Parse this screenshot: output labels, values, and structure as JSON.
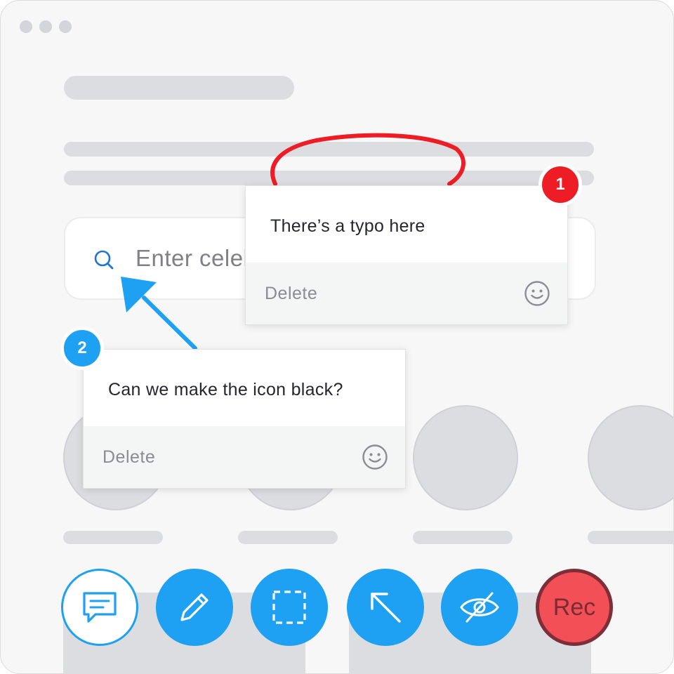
{
  "search": {
    "placeholder": "Enter celebrity name"
  },
  "comments": [
    {
      "number": "1",
      "text": "There’s a typo here",
      "delete_label": "Delete",
      "badge_color": "#ee1c25"
    },
    {
      "number": "2",
      "text": "Can we make the icon black?",
      "delete_label": "Delete",
      "badge_color": "#1ea1f2"
    }
  ],
  "toolbar": {
    "tools": [
      {
        "name": "comment",
        "icon": "comment-icon",
        "active": true
      },
      {
        "name": "draw",
        "icon": "pencil-icon"
      },
      {
        "name": "select-area",
        "icon": "dashed-square-icon"
      },
      {
        "name": "arrow",
        "icon": "arrow-up-left-icon"
      },
      {
        "name": "hide",
        "icon": "eye-off-icon"
      }
    ],
    "rec_label": "Rec"
  },
  "colors": {
    "accent": "#1ea1f2",
    "annotation_red": "#ee1c25",
    "rec": "#f24f57"
  }
}
